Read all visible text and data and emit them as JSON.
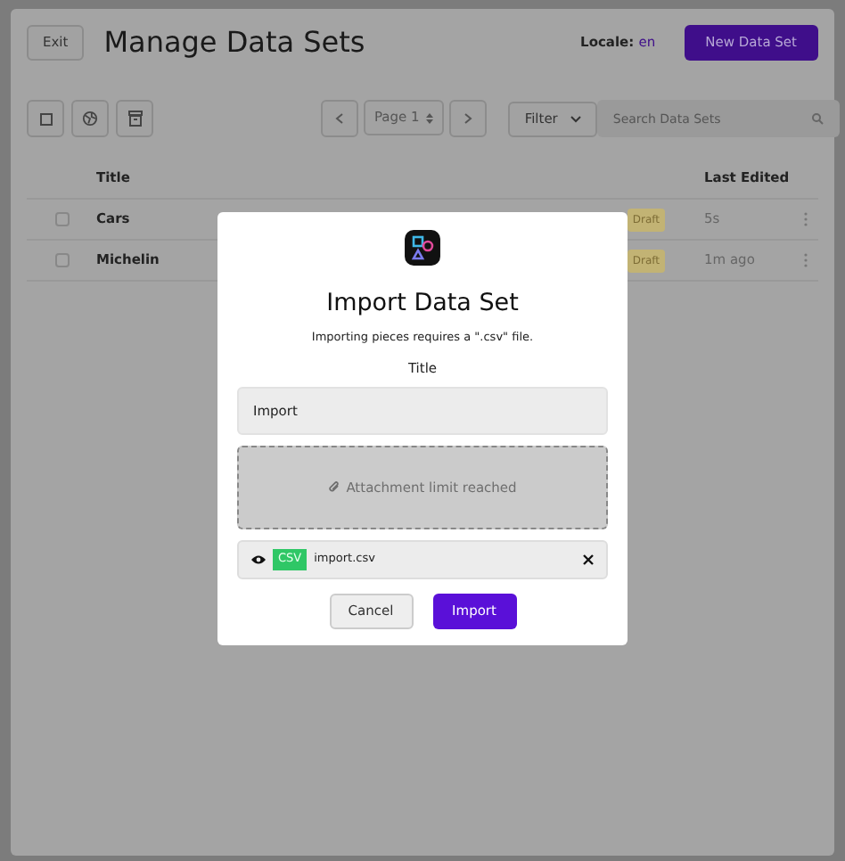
{
  "header": {
    "exit_button": "Exit",
    "title": "Manage Data Sets",
    "locale_label": "Locale:",
    "locale_value": "en",
    "new_button": "New Data Set"
  },
  "toolbar": {
    "page_select": "Page 1",
    "filter_button": "Filter",
    "search": {
      "placeholder": "Search Data Sets"
    }
  },
  "table": {
    "columns": [
      "Title",
      "Last Edited"
    ],
    "rows": [
      {
        "title": "Cars",
        "status": "Draft",
        "last_edited": "5s",
        "checked": false
      },
      {
        "title": "Michelin",
        "status": "Draft",
        "last_edited": "1m ago",
        "checked": false
      }
    ]
  },
  "dialog": {
    "title": "Import Data Set",
    "subtitle": "Importing pieces requires a \".csv\" file.",
    "field_label": "Title",
    "field_value": "Import",
    "dropzone": {
      "text": "Attachment limit reached",
      "disabled": true
    },
    "file": {
      "type": "CSV",
      "name": "import.csv"
    },
    "buttons": [
      {
        "label": "Cancel",
        "kind": "secondary"
      },
      {
        "label": "Import",
        "kind": "primary"
      }
    ]
  }
}
